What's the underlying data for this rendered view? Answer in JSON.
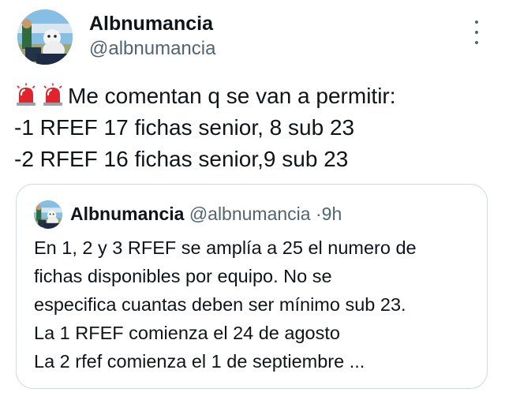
{
  "tweet": {
    "author_name": "Albnumancia",
    "author_handle": "@albnumancia",
    "text_lines": [
      "Me comentan q se van a permitir:",
      "-1 RFEF 17 fichas senior, 8 sub 23",
      "-2 RFEF 16 fichas senior,9 sub 23"
    ],
    "emoji": [
      "police-car-light-icon",
      "police-car-light-icon"
    ]
  },
  "quoted": {
    "author_name": "Albnumancia",
    "author_handle": "@albnumancia",
    "separator": "·",
    "time": "9h",
    "text_lines": [
      "En 1, 2 y 3 RFEF se amplía a 25 el numero de",
      "fichas disponibles por equipo. No se",
      "especifica cuantas deben ser mínimo sub 23.",
      "La 1 RFEF comienza el 24 de agosto",
      "La 2 rfef comienza el 1 de septiembre ..."
    ]
  },
  "colors": {
    "text": "#0f1419",
    "secondary": "#536471",
    "border": "#cfd9de",
    "siren": "#e0242b"
  }
}
